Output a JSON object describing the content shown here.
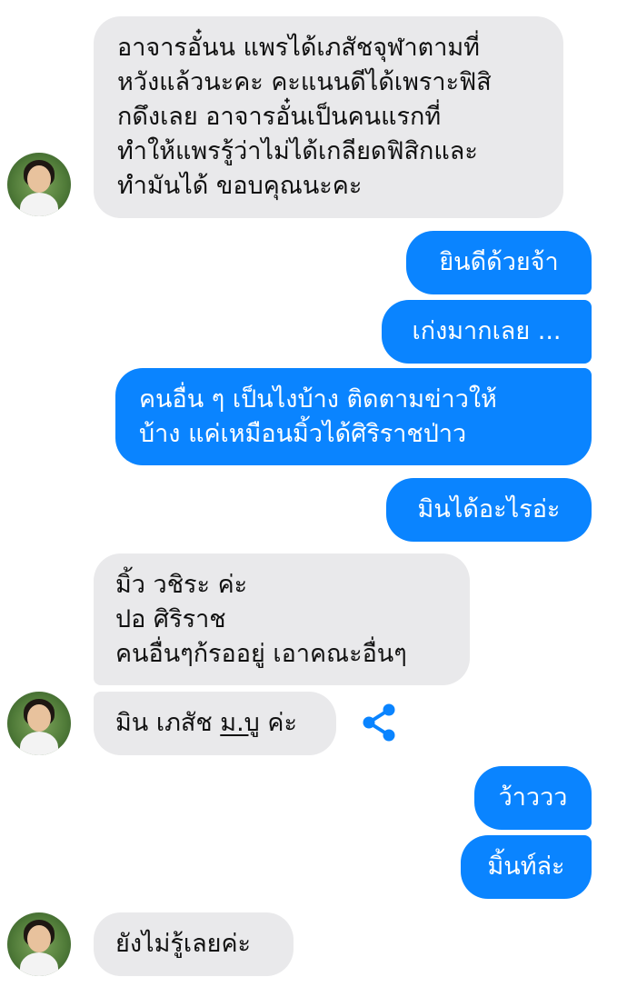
{
  "messages": [
    {
      "id": "m1",
      "side": "in",
      "text": "อาจารอั๋นน แพรได้เภสัชจุฬาตามที่\nหวังแล้วนะคะ คะแนนดีได้เพราะฟิสิ\nกดึงเลย อาจารอั๋นเป็นคนแรกที่\nทำให้แพรรู้ว่าไม่ได้เกลียดฟิสิกและ\nทำมันได้ ขอบคุณนะคะ"
    },
    {
      "id": "m2",
      "side": "out",
      "text": "ยินดีด้วยจ้า"
    },
    {
      "id": "m3",
      "side": "out",
      "text": "เก่งมากเลย ..."
    },
    {
      "id": "m4",
      "side": "out",
      "text": "คนอื่น ๆ เป็นไงบ้าง ติดตามข่าวให้\nบ้าง แค่เหมือนมิ้วได้ศิริราชป่าว"
    },
    {
      "id": "m5",
      "side": "out",
      "text": "มินได้อะไรอ่ะ"
    },
    {
      "id": "m6",
      "side": "in",
      "text": "มิ้ว วชิระ ค่ะ\nปอ ศิริราช\nคนอื่นๆก้รออยู่ เอาคณะอื่นๆ"
    },
    {
      "id": "m7",
      "side": "in",
      "text_before": "มิน เภสัช ",
      "text_link": "ม.บู",
      "text_after": " ค่ะ"
    },
    {
      "id": "m8",
      "side": "out",
      "text": "ว้าววว"
    },
    {
      "id": "m9",
      "side": "out",
      "text": "มิ้นท์ล่ะ"
    },
    {
      "id": "m10",
      "side": "in",
      "text": "ยังไม่รู้เลยค่ะ"
    }
  ],
  "icons": {
    "share": "share-icon",
    "avatar": "contact-avatar"
  },
  "colors": {
    "outgoing": "#0a84ff",
    "incoming": "#e9e9eb",
    "share_icon": "#0a84ff"
  }
}
